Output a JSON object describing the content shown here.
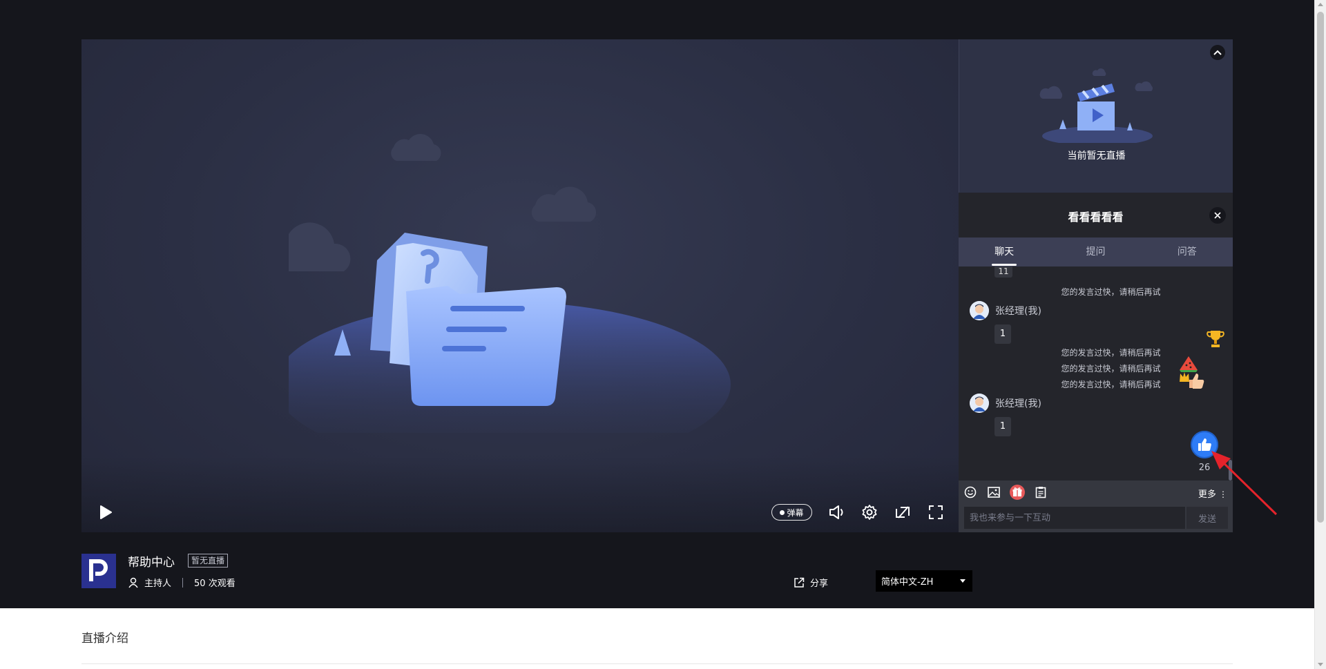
{
  "player": {
    "danmu_label": "弹幕",
    "no_live_text": "当前暂无直播"
  },
  "chat": {
    "title": "看看看看看",
    "tabs": [
      "聊天",
      "提问",
      "问答"
    ],
    "partial_bubble": "11",
    "system_message": "您的发言过快，请稍后再试",
    "user_name": "张经理(我)",
    "message_text": "1",
    "like_count": "26",
    "more_label": "更多",
    "input_placeholder": "我也来参与一下互动",
    "send_label": "发送"
  },
  "info": {
    "title": "帮助中心",
    "status_tag": "暂无直播",
    "host_label": "主持人",
    "views": "50 次观看",
    "share_label": "分享",
    "language": "简体中文-ZH"
  },
  "intro": {
    "heading": "直播介绍"
  },
  "colors": {
    "accent": "#2e7cf6",
    "annotation": "#e5232b",
    "dark_bg": "#15161c"
  }
}
